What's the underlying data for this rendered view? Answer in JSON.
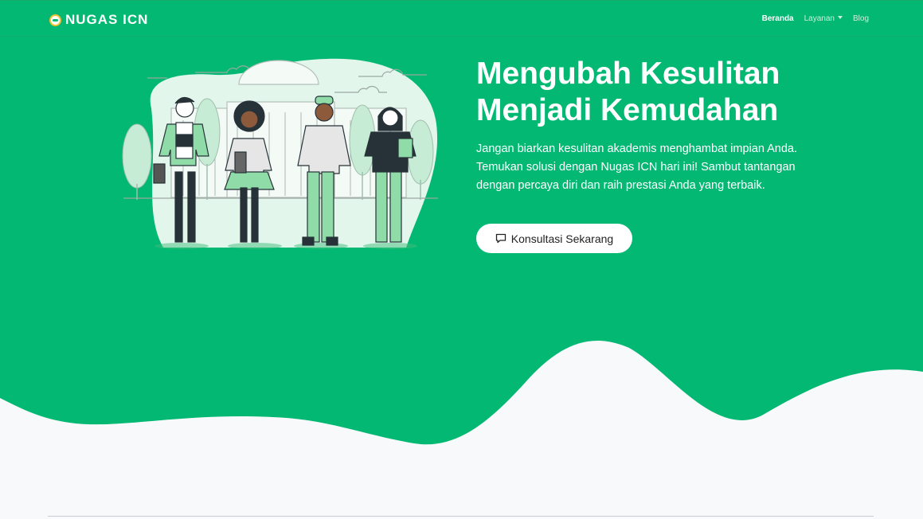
{
  "brand": {
    "name": "NUGAS ICN"
  },
  "nav": {
    "items": [
      {
        "label": "Beranda",
        "active": true
      },
      {
        "label": "Layanan",
        "dropdown": true
      },
      {
        "label": "Blog"
      }
    ]
  },
  "hero": {
    "headline": "Mengubah Kesulitan Menjadi Kemudahan",
    "lead": "Jangan biarkan kesulitan akademis menghambat impian Anda. Temukan solusi dengan Nugas ICN hari ini! Sambut tantangan dengan percaya diri dan raih prestasi Anda yang terbaik.",
    "cta_label": "Konsultasi Sekarang",
    "cta_icon": "chat-bubble-icon"
  },
  "colors": {
    "primary": "#02b872",
    "background": "#f8f9fb",
    "illustration_light": "#d7f3e4",
    "illustration_mid": "#8fdca8",
    "text_light": "#ffffff"
  }
}
